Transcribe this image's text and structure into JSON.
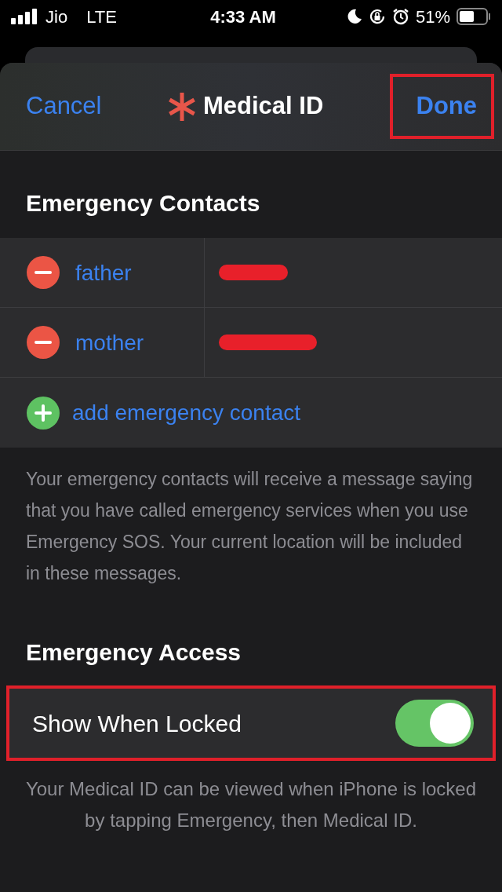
{
  "status_bar": {
    "carrier": "Jio",
    "network": "LTE",
    "time": "4:33 AM",
    "battery": "51%"
  },
  "nav": {
    "cancel": "Cancel",
    "title": "Medical ID",
    "done": {
      "label": "Done",
      "highlighted": true
    }
  },
  "contacts_section": {
    "title": "Emergency Contacts",
    "contacts": [
      {
        "relation": "father",
        "name_redacted": true
      },
      {
        "relation": "mother",
        "name_redacted": true
      }
    ],
    "add_label": "add emergency contact",
    "footer": "Your emergency contacts will receive a message saying that you have called emergency services when you use Emergency SOS. Your current location will be included in these messages."
  },
  "access_section": {
    "title": "Emergency Access",
    "row": {
      "label": "Show When Locked",
      "on": true,
      "highlighted": true
    },
    "footer": "Your Medical ID can be viewed when iPhone is locked by tapping Emergency, then Medical ID."
  }
}
